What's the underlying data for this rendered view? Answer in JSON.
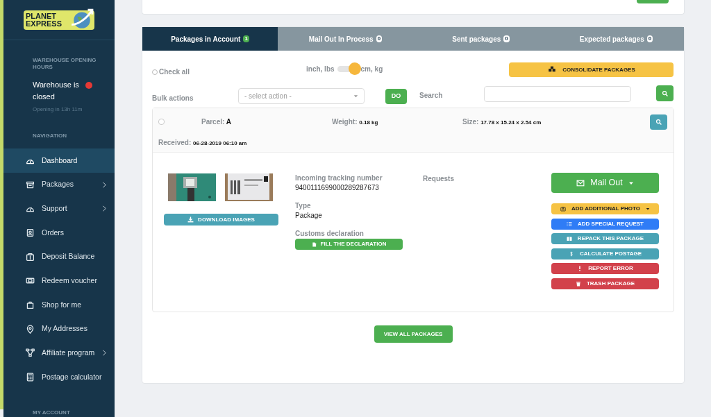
{
  "logo": {
    "line_1": "PLANET",
    "line_2": "EXPRESS"
  },
  "warehouse": {
    "heading": "WAREHOUSE OPENING HOURS",
    "status": "Warehouse is closed",
    "open": false,
    "note": "Opening in 13h 11m"
  },
  "navigation": {
    "heading": "NAVIGATION",
    "items": [
      {
        "label": "Dashboard",
        "selected": true,
        "has_submenu": false
      },
      {
        "label": "Packages",
        "selected": false,
        "has_submenu": true
      },
      {
        "label": "Support",
        "selected": false,
        "has_submenu": true
      },
      {
        "label": "Orders",
        "selected": false,
        "has_submenu": false
      },
      {
        "label": "Deposit Balance",
        "selected": false,
        "has_submenu": false
      },
      {
        "label": "Redeem voucher",
        "selected": false,
        "has_submenu": false
      },
      {
        "label": "Shop for me",
        "selected": false,
        "has_submenu": false
      },
      {
        "label": "My Addresses",
        "selected": false,
        "has_submenu": false
      },
      {
        "label": "Affiliate program",
        "selected": false,
        "has_submenu": true
      },
      {
        "label": "Postage calculator",
        "selected": false,
        "has_submenu": false
      }
    ]
  },
  "account_heading": "MY ACCOUNT",
  "tabs": [
    {
      "label": "Packages in Account",
      "count": "1",
      "selected": true
    },
    {
      "label": "Mail Out In Process",
      "count": "0",
      "selected": false
    },
    {
      "label": "Sent packages",
      "count": "0",
      "selected": false
    },
    {
      "label": "Expected packages",
      "count": "0",
      "selected": false
    }
  ],
  "toolbar": {
    "check_all": {
      "label": "Check all",
      "checked": false
    },
    "units": {
      "left": "inch, lbs",
      "right": "cm, kg",
      "on": true
    },
    "consolidate": "CONSOLIDATE PACKAGES",
    "bulk_label": "Bulk actions",
    "bulk_placeholder": "- select action -",
    "do": "DO",
    "search_label": "Search"
  },
  "parcel": {
    "checked": false,
    "parcel_label": "Parcel:",
    "parcel": "A",
    "weight_label": "Weight:",
    "weight": "0.18 kg",
    "size_label": "Size:",
    "size": "17.78 x 15.24 x 2.54 cm",
    "received_label": "Received:",
    "received": "06-28-2019 06:10 am",
    "download": "DOWNLOAD IMAGES",
    "fields": [
      {
        "label": "Incoming tracking number",
        "value": "9400111699000289287673"
      },
      {
        "label": "Type",
        "value": "Package"
      },
      {
        "label": "Customs declaration",
        "button": "FILL THE DECLARATION"
      }
    ],
    "requests_label": "Requests",
    "mail_out": "Mail Out",
    "actions": [
      {
        "label": "ADD ADDITIONAL PHOTO",
        "color": "#f6c344",
        "has_menu": true
      },
      {
        "label": "ADD SPECIAL REQUEST",
        "color": "#2f7cf6",
        "has_menu": false
      },
      {
        "label": "REPACK THIS PACKAGE",
        "color": "#4aa3b5",
        "has_menu": false
      },
      {
        "label": "CALCULATE POSTAGE",
        "color": "#4aa3b5",
        "has_menu": false
      },
      {
        "label": "REPORT ERROR",
        "color": "#d2414b",
        "has_menu": false
      },
      {
        "label": "TRASH PACKAGE",
        "color": "#d2414b",
        "has_menu": false
      }
    ]
  },
  "view_all": "VIEW ALL PACKAGES"
}
